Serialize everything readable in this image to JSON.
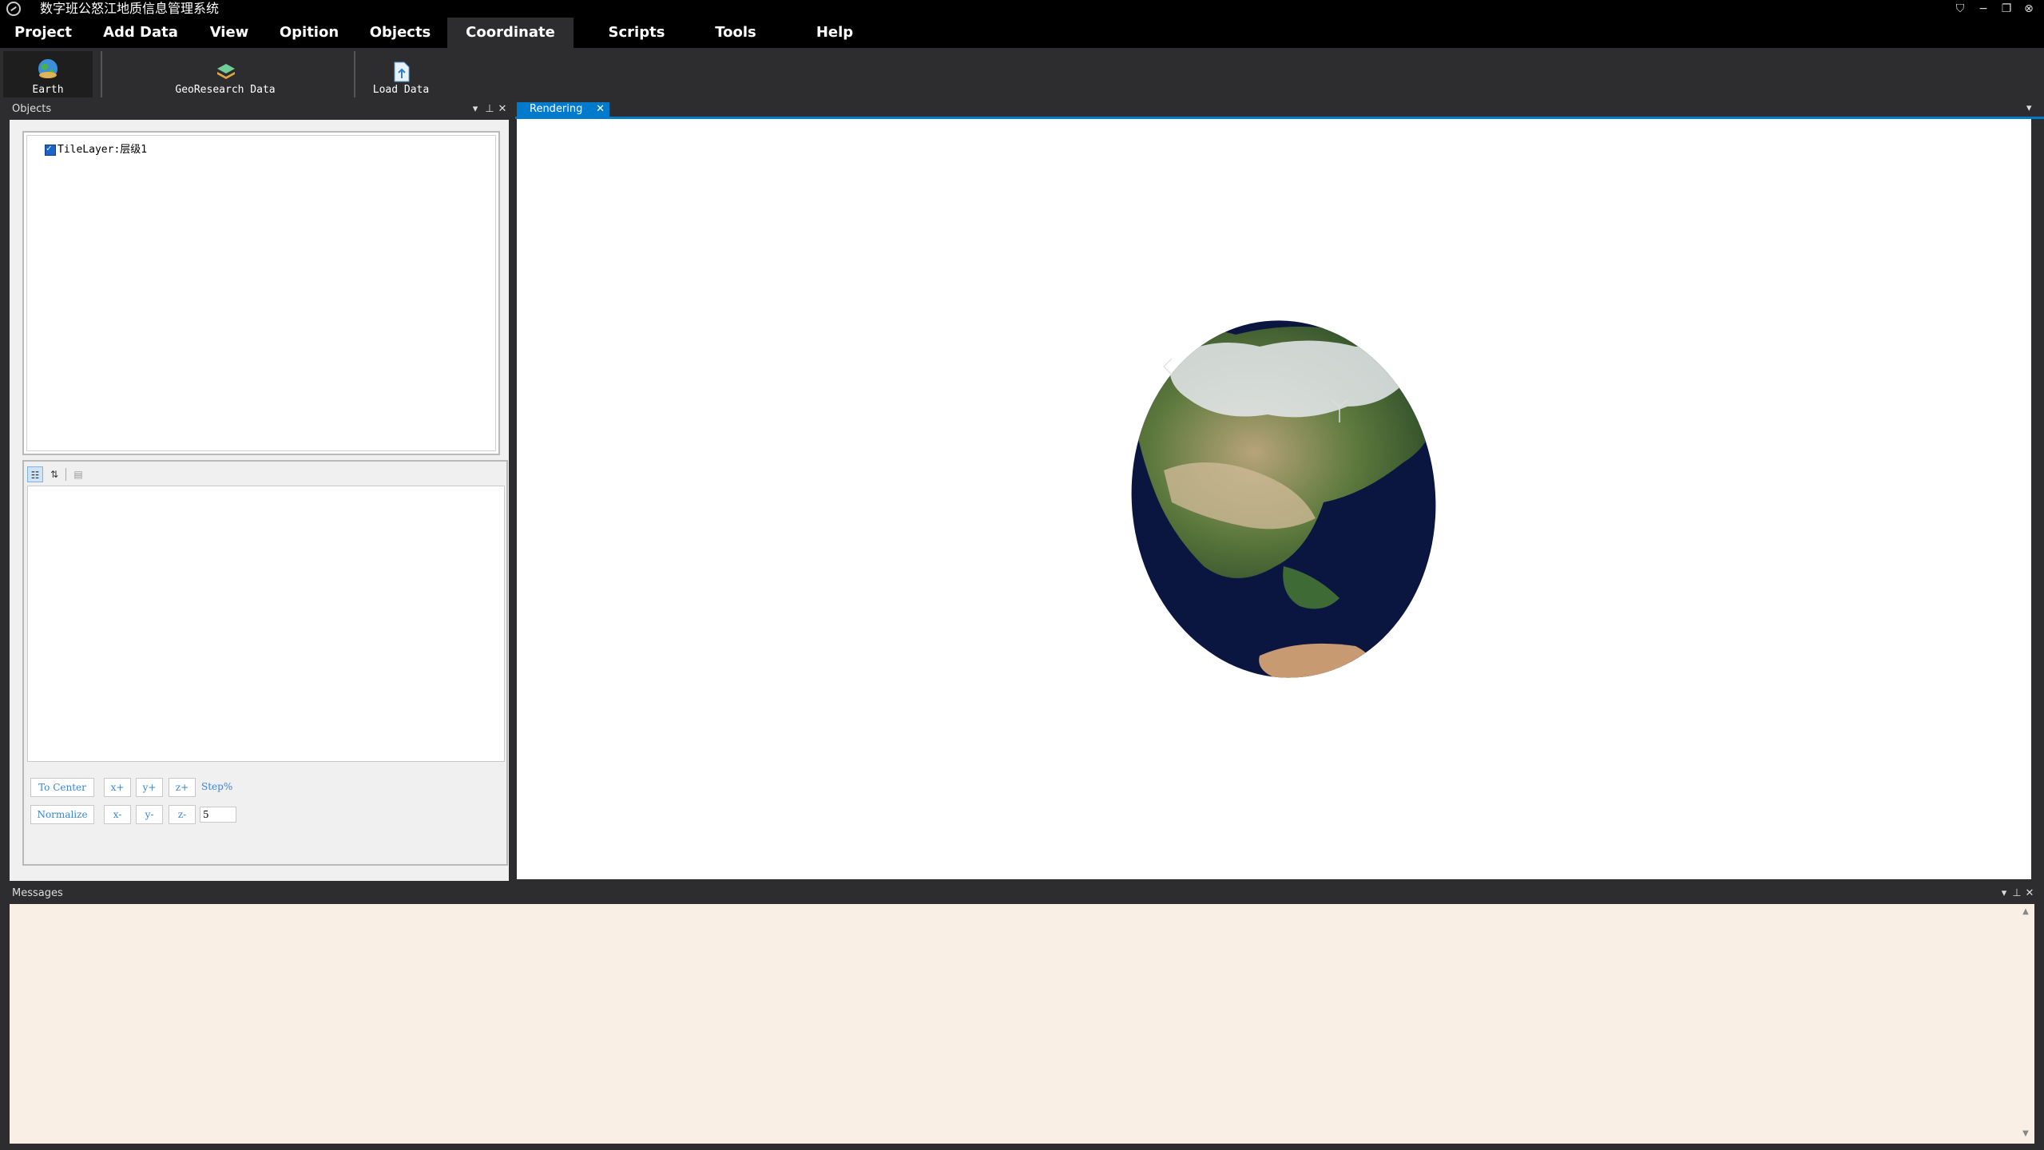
{
  "window": {
    "title": "数字班公怒江地质信息管理系统",
    "app_icon": "app-logo-icon",
    "controls": [
      "skin-icon",
      "minimize-icon",
      "restore-icon",
      "close-icon"
    ],
    "control_glyphs": [
      "⛉",
      "−",
      "❐",
      "⊗"
    ]
  },
  "menu": {
    "items": [
      "Project",
      "Add Data",
      "View",
      "Opition",
      "Objects",
      "Coordinate",
      "Scripts",
      "Tools",
      "Help"
    ],
    "active": "Coordinate"
  },
  "ribbon": {
    "earth_label": "Earth",
    "georesearch_label": "GeoResearch Data",
    "load_label": "Load Data"
  },
  "objects_panel": {
    "title": "Objects",
    "tree": {
      "item_label": "TileLayer:层级1",
      "checked": true
    },
    "property_toolbar": [
      "categorized-icon",
      "alphabetical-sort-icon",
      "property-pages-icon"
    ],
    "property_toolbar_glyphs": [
      "☷",
      "⇅",
      "▤"
    ],
    "controls": {
      "to_center": "To Center",
      "normalize": "Normalize",
      "x_plus": "x+",
      "y_plus": "y+",
      "z_plus": "z+",
      "x_minus": "x-",
      "y_minus": "y-",
      "z_minus": "z-",
      "step_label": "Step%",
      "step_value": "5"
    }
  },
  "rendering": {
    "tab_label": "Rendering",
    "tab_close": "✕"
  },
  "messages_panel": {
    "title": "Messages",
    "content": ""
  },
  "panel_ctl_glyphs": {
    "dropdown": "▾",
    "pin": "⊥",
    "close": "✕"
  },
  "colors": {
    "accent": "#007acc",
    "menu_bg": "#000000",
    "chrome_bg": "#2d2d30",
    "messages_bg": "#faefe5",
    "control_text": "#3a84d6"
  }
}
